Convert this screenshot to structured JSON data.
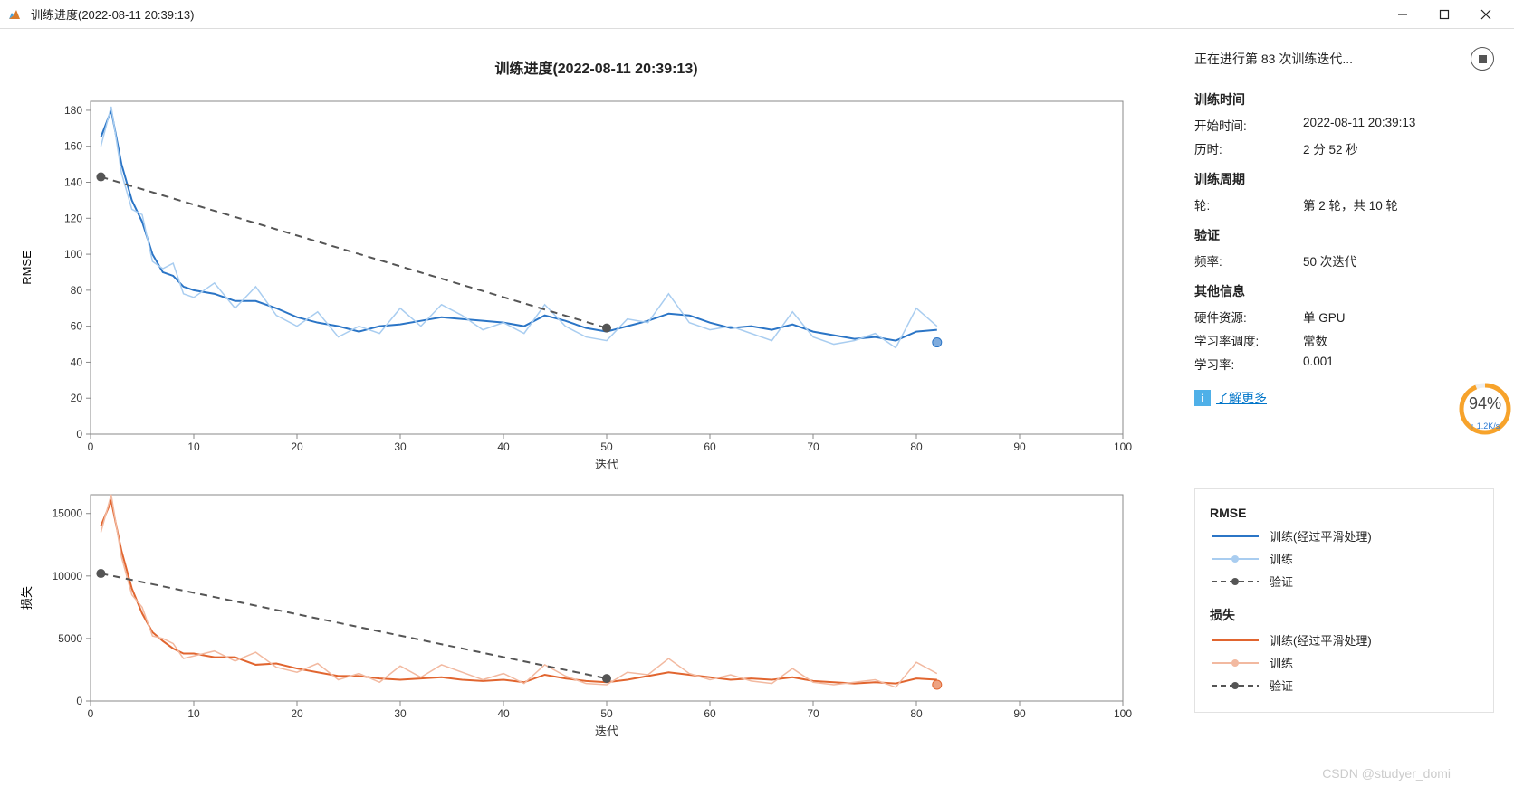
{
  "window_title": "训练进度(2022-08-11 20:39:13)",
  "main_title": "训练进度(2022-08-11 20:39:13)",
  "status_text": "正在进行第 83 次训练迭代...",
  "side": {
    "time_heading": "训练时间",
    "start_time_label": "开始时间:",
    "start_time_value": "2022-08-11 20:39:13",
    "elapsed_label": "历时:",
    "elapsed_value": "2 分 52 秒",
    "cycle_heading": "训练周期",
    "epoch_label": "轮:",
    "epoch_value": "第 2 轮，共 10 轮",
    "validation_heading": "验证",
    "freq_label": "频率:",
    "freq_value": "50 次迭代",
    "other_heading": "其他信息",
    "hardware_label": "硬件资源:",
    "hardware_value": "单 GPU",
    "lr_sched_label": "学习率调度:",
    "lr_sched_value": "常数",
    "lr_label": "学习率:",
    "lr_value": "0.001",
    "learn_more": "了解更多"
  },
  "legend": {
    "rmse_heading": "RMSE",
    "loss_heading": "损失",
    "train_smoothed": "训练(经过平滑处理)",
    "train": "训练",
    "validation": "验证"
  },
  "gauge": {
    "percent": "94%",
    "rate": "↑ 1.2K/s"
  },
  "watermark": "CSDN @studyer_domi",
  "chart_data": [
    {
      "type": "line",
      "title": "RMSE",
      "xlabel": "迭代",
      "ylabel": "RMSE",
      "xlim": [
        0,
        100
      ],
      "ylim": [
        0,
        185
      ],
      "yticks": [
        0,
        20,
        40,
        60,
        80,
        100,
        120,
        140,
        160,
        180
      ],
      "xticks": [
        0,
        10,
        20,
        30,
        40,
        50,
        60,
        70,
        80,
        90,
        100
      ],
      "series": [
        {
          "name": "训练(经过平滑处理)",
          "color": "#2b75c6",
          "stroke": 2,
          "x": [
            1,
            2,
            3,
            4,
            5,
            6,
            7,
            8,
            9,
            10,
            12,
            14,
            16,
            18,
            20,
            22,
            24,
            26,
            28,
            30,
            32,
            34,
            36,
            38,
            40,
            42,
            44,
            46,
            48,
            50,
            52,
            54,
            56,
            58,
            60,
            62,
            64,
            66,
            68,
            70,
            72,
            74,
            76,
            78,
            80,
            82
          ],
          "y": [
            165,
            180,
            150,
            130,
            118,
            100,
            90,
            88,
            82,
            80,
            78,
            74,
            74,
            70,
            65,
            62,
            60,
            57,
            60,
            61,
            63,
            65,
            64,
            63,
            62,
            60,
            66,
            63,
            59,
            57,
            60,
            63,
            67,
            66,
            62,
            59,
            60,
            58,
            61,
            57,
            55,
            53,
            54,
            52,
            57,
            58,
            56,
            51
          ]
        },
        {
          "name": "训练",
          "color": "#a9cdf0",
          "stroke": 1.5,
          "x": [
            1,
            2,
            3,
            4,
            5,
            6,
            7,
            8,
            9,
            10,
            12,
            14,
            16,
            18,
            20,
            22,
            24,
            26,
            28,
            30,
            32,
            34,
            36,
            38,
            40,
            42,
            44,
            46,
            48,
            50,
            52,
            54,
            56,
            58,
            60,
            62,
            64,
            66,
            68,
            70,
            72,
            74,
            76,
            78,
            80,
            82
          ],
          "y": [
            160,
            182,
            145,
            125,
            122,
            96,
            92,
            95,
            78,
            76,
            84,
            70,
            82,
            66,
            60,
            68,
            54,
            60,
            56,
            70,
            60,
            72,
            66,
            58,
            62,
            56,
            72,
            60,
            54,
            52,
            64,
            62,
            78,
            62,
            58,
            60,
            56,
            52,
            68,
            54,
            50,
            52,
            56,
            48,
            70,
            60,
            48,
            52
          ]
        },
        {
          "name": "验证",
          "color": "#555",
          "stroke": 2,
          "dash": true,
          "markers": true,
          "x": [
            1,
            50
          ],
          "y": [
            143,
            59
          ]
        }
      ],
      "last_marker_rmse": {
        "x": 82,
        "y": 51
      }
    },
    {
      "type": "line",
      "title": "损失",
      "xlabel": "迭代",
      "ylabel": "损失",
      "xlim": [
        0,
        100
      ],
      "ylim": [
        0,
        16500
      ],
      "yticks": [
        0,
        5000,
        10000,
        15000
      ],
      "xticks": [
        0,
        10,
        20,
        30,
        40,
        50,
        60,
        70,
        80,
        90,
        100
      ],
      "series": [
        {
          "name": "训练(经过平滑处理)",
          "color": "#e1652f",
          "stroke": 2,
          "x": [
            1,
            2,
            3,
            4,
            5,
            6,
            7,
            8,
            9,
            10,
            12,
            14,
            16,
            18,
            20,
            22,
            24,
            26,
            28,
            30,
            32,
            34,
            36,
            38,
            40,
            42,
            44,
            46,
            48,
            50,
            52,
            54,
            56,
            58,
            60,
            62,
            64,
            66,
            68,
            70,
            72,
            74,
            76,
            78,
            80,
            82
          ],
          "y": [
            14000,
            16000,
            12000,
            9000,
            7000,
            5500,
            4800,
            4200,
            3800,
            3800,
            3500,
            3500,
            2900,
            3000,
            2600,
            2300,
            2000,
            2000,
            1800,
            1700,
            1800,
            1900,
            1700,
            1600,
            1700,
            1500,
            2100,
            1800,
            1600,
            1500,
            1700,
            2000,
            2300,
            2100,
            1900,
            1700,
            1800,
            1700,
            1900,
            1600,
            1500,
            1400,
            1500,
            1400,
            1800,
            1700,
            1500,
            1300
          ]
        },
        {
          "name": "训练",
          "color": "#f2b9a0",
          "stroke": 1.5,
          "x": [
            1,
            2,
            3,
            4,
            5,
            6,
            7,
            8,
            9,
            10,
            12,
            14,
            16,
            18,
            20,
            22,
            24,
            26,
            28,
            30,
            32,
            34,
            36,
            38,
            40,
            42,
            44,
            46,
            48,
            50,
            52,
            54,
            56,
            58,
            60,
            62,
            64,
            66,
            68,
            70,
            72,
            74,
            76,
            78,
            80,
            82
          ],
          "y": [
            13500,
            16500,
            11500,
            8500,
            7500,
            5200,
            5000,
            4600,
            3400,
            3600,
            4000,
            3200,
            3900,
            2700,
            2300,
            3000,
            1700,
            2200,
            1500,
            2800,
            1900,
            2900,
            2300,
            1700,
            2200,
            1400,
            2900,
            2000,
            1400,
            1300,
            2300,
            2100,
            3400,
            2200,
            1700,
            2100,
            1600,
            1400,
            2600,
            1500,
            1300,
            1500,
            1700,
            1100,
            3100,
            2200,
            1200,
            1400
          ]
        },
        {
          "name": "验证",
          "color": "#555",
          "stroke": 2,
          "dash": true,
          "markers": true,
          "x": [
            1,
            50
          ],
          "y": [
            10200,
            1800
          ]
        }
      ],
      "last_marker_loss": {
        "x": 82,
        "y": 1300
      }
    }
  ]
}
